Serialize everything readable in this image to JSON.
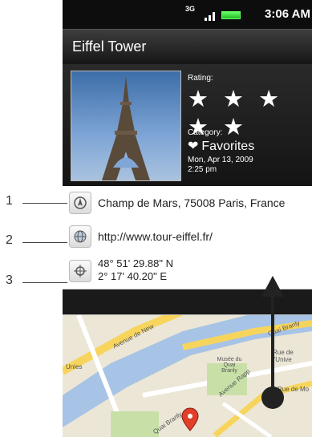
{
  "status_bar": {
    "network": "3G",
    "time": "3:06 AM"
  },
  "title": "Eiffel Tower",
  "header": {
    "rating_label": "Rating:",
    "stars": "★ ★ ★ ★ ★",
    "category_label": "Category:",
    "category_value": "Favorites",
    "date_line1": "Mon, Apr 13, 2009",
    "date_line2": "2:25 pm"
  },
  "details": [
    {
      "icon": "navigation-icon",
      "text": "Champ de Mars, 75008 Paris, France"
    },
    {
      "icon": "globe-icon",
      "text": "http://www.tour-eiffel.fr/"
    },
    {
      "icon": "location-icon",
      "text_line1": "48° 51' 29.88\" N",
      "text_line2": "2° 17' 40.20\" E"
    }
  ],
  "callouts": [
    "1",
    "2",
    "3"
  ],
  "map_labels": [
    "Quai Branly",
    "Rue de l'Unive",
    "Avenue de New",
    "Musée du Quai Branly",
    "Rue de Mo",
    "Avenue Rapp",
    "Unies",
    "Quai Branly"
  ]
}
